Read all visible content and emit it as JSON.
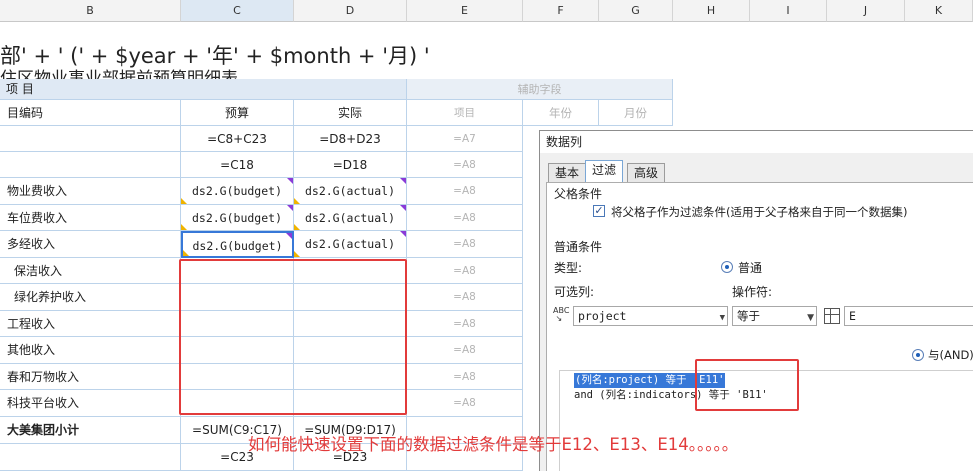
{
  "columns": [
    "B",
    "C",
    "D",
    "E",
    "F",
    "G",
    "H",
    "I",
    "J",
    "K"
  ],
  "formula_line": "部' + ' (' + $year + '年' + $month + '月) '",
  "sub_title_partial": "住区物业事业部据前预算明细表",
  "header_left": "项 目",
  "aux_header": "辅助字段",
  "rows": [
    {
      "label": "目编码",
      "budget": "预算",
      "actual": "实际",
      "e": "项目",
      "f": "年份",
      "g": "月份"
    },
    {
      "label": "",
      "budget": "=C8+C23",
      "actual": "=D8+D23",
      "e": "=A7"
    },
    {
      "label": "",
      "budget": "=C18",
      "actual": "=D18",
      "e": "=A8"
    },
    {
      "label": "物业费收入",
      "budget": "ds2.G(budget)",
      "actual": "ds2.G(actual)",
      "e": "=A8"
    },
    {
      "label": "车位费收入",
      "budget": "ds2.G(budget)",
      "actual": "ds2.G(actual)",
      "e": "=A8"
    },
    {
      "label": "多经收入",
      "budget": "ds2.G(budget)",
      "actual": "ds2.G(actual)",
      "e": "=A8"
    },
    {
      "label": "保洁收入",
      "budget": "",
      "actual": "",
      "e": "=A8"
    },
    {
      "label": "绿化养护收入",
      "budget": "",
      "actual": "",
      "e": "=A8"
    },
    {
      "label": "工程收入",
      "budget": "",
      "actual": "",
      "e": "=A8"
    },
    {
      "label": "其他收入",
      "budget": "",
      "actual": "",
      "e": "=A8"
    },
    {
      "label": "春和万物收入",
      "budget": "",
      "actual": "",
      "e": "=A8"
    },
    {
      "label": "科技平台收入",
      "budget": "",
      "actual": "",
      "e": "=A8"
    },
    {
      "label": "大美集团小计",
      "budget": "=SUM(C9:C17)",
      "actual": "=SUM(D9:D17)",
      "e": ""
    },
    {
      "label": "",
      "budget": "=C23",
      "actual": "=D23",
      "e": ""
    }
  ],
  "dialog": {
    "title": "数据列",
    "tabs": [
      "基本",
      "过滤",
      "高级"
    ],
    "parent_cond_label": "父格条件",
    "parent_checkbox": "将父格子作为过滤条件(适用于父子格来自于同一个数据集)",
    "normal_cond_label": "普通条件",
    "type_label": "类型:",
    "type_option": "普通",
    "optional_col_label": "可选列:",
    "operator_label": "操作符:",
    "column_value": "project",
    "operator_value": "等于",
    "value_field": "E",
    "and_radio": "与(AND)",
    "cond1": "(列名:project) 等于 'E11'",
    "cond2_prefix": "and (列名:indicators)",
    "cond2_suffix": "等于 'B11'"
  },
  "question": "如何能快速设置下面的数据过滤条件是等于E12、E13、E14。。。。。",
  "colors": {
    "accent": "#e23b3b",
    "select": "#3778d8",
    "grid": "#bcd3ea"
  }
}
